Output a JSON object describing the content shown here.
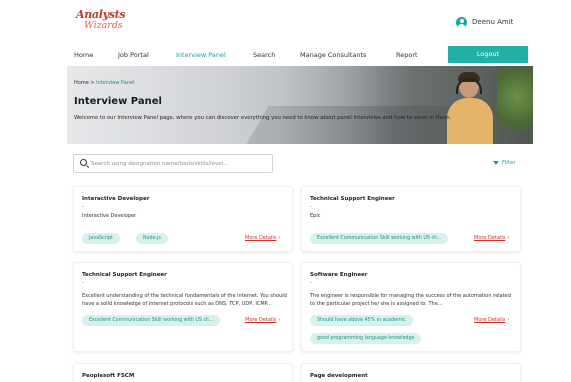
{
  "brand": {
    "line1": "Analysts",
    "line2": "Wizards"
  },
  "user": {
    "name": "Deenu Amit",
    "icon": "user-avatar-icon"
  },
  "nav": {
    "items": [
      {
        "label": "Home"
      },
      {
        "label": "Job Portal"
      },
      {
        "label": "Interview Panel"
      },
      {
        "label": "Search"
      },
      {
        "label": "Manage Consultants"
      },
      {
        "label": "Report"
      }
    ],
    "active": "Interview Panel",
    "logout_label": "Logout"
  },
  "hero": {
    "breadcrumb_home": "Home",
    "breadcrumb_sep": ">",
    "breadcrumb_current": "Interview Panel",
    "title": "Interview Panel",
    "description": "Welcome to our Interview Panel page, where you can discover everything you need to know about panel interviews and how to excel in them."
  },
  "search": {
    "placeholder": "Search using designation name/tools/skills/level...",
    "value": "",
    "icon": "search-icon"
  },
  "filter": {
    "label": "Filter",
    "icon": "filter-icon"
  },
  "cards": [
    {
      "title": "Interactive Developer",
      "dash": "-",
      "description": "Interactive Developer",
      "tags": [
        "JavaScript",
        "Node.js"
      ],
      "more_label": "More Details"
    },
    {
      "title": "Technical Support Engineer",
      "dash": "-",
      "description": "Epic",
      "tags": [
        "Excellent Communication Skill working with US cli..."
      ],
      "more_label": "More Details"
    },
    {
      "title": "Technical Support Engineer",
      "dash": "-",
      "description": "Excellent understanding of the technical fundamentals of the internet. You should have a solid knowledge of internet protocols such as DNS, TCP, UDP, ICMP...",
      "tags": [
        "Excellent Communication Skill working with US cli..."
      ],
      "more_label": "More Details"
    },
    {
      "title": "Software Engineer",
      "dash": "-",
      "description": "The engineer is responsible for managing the success of the automation related to the particular project he/ she is assigned to. The...",
      "tags": [
        "Should have above 45% in academic",
        "good programming language knowledge"
      ],
      "more_label": "More Details"
    },
    {
      "title": "Peoplesoft FSCM",
      "dash": "",
      "description": "",
      "tags": [],
      "more_label": ""
    },
    {
      "title": "Page development",
      "dash": "",
      "description": "",
      "tags": [],
      "more_label": ""
    }
  ],
  "colors": {
    "accent": "#21b0a6",
    "link_red": "#d0332a",
    "tag_bg": "#d8f1ee",
    "brand_red": "#c0392b"
  }
}
